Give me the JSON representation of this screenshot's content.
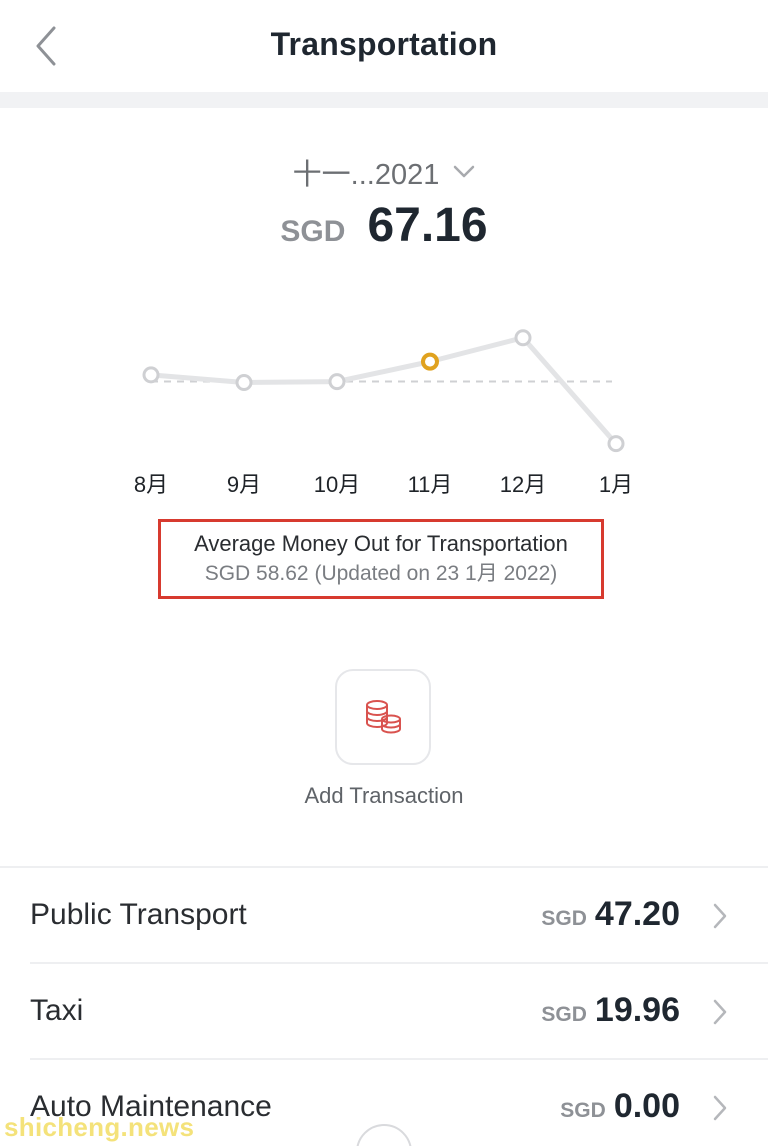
{
  "header": {
    "title": "Transportation",
    "back_icon": "chevron-left-icon"
  },
  "period": {
    "label": "十一...2021",
    "dropdown_icon": "chevron-down-icon"
  },
  "total": {
    "currency": "SGD",
    "amount": "67.16"
  },
  "chart_data": {
    "type": "line",
    "categories": [
      "8月",
      "9月",
      "10月",
      "11月",
      "12月",
      "1月"
    ],
    "series": [
      {
        "values": [
          61.5,
          58.2,
          58.6,
          67.16,
          77.4,
          32.0
        ]
      }
    ],
    "selected_index": 3,
    "average_line": 58.62,
    "ylim": [
      25,
      85
    ],
    "title": "",
    "xlabel": "",
    "ylabel": "",
    "colors": {
      "line": "#e3e4e6",
      "point": "#cfd0d3",
      "selected": "#e0a21f",
      "average": "#cfd0d3"
    }
  },
  "average": {
    "title": "Average Money Out for Transportation",
    "subtitle": "SGD 58.62 (Updated on 23 1月 2022)"
  },
  "add_transaction": {
    "label": "Add Transaction",
    "icon": "coins-icon"
  },
  "categories": [
    {
      "label": "Public Transport",
      "currency": "SGD",
      "amount": "47.20"
    },
    {
      "label": "Taxi",
      "currency": "SGD",
      "amount": "19.96"
    },
    {
      "label": "Auto Maintenance",
      "currency": "SGD",
      "amount": "0.00"
    }
  ],
  "watermark": "shicheng.news",
  "colors": {
    "accent": "#e0a21f",
    "highlight_box": "#d73a2f",
    "icon_red": "#d9534f"
  }
}
